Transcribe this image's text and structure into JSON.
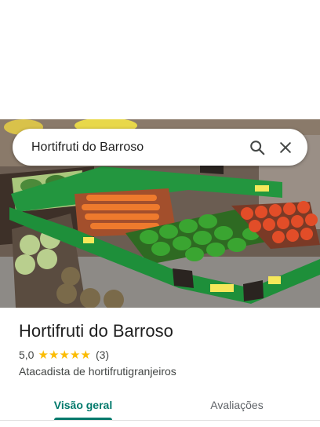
{
  "search": {
    "query": "Hortifruti do Barroso"
  },
  "icons": {
    "search": "search-icon",
    "close": "close-icon",
    "star": "star-icon"
  },
  "place": {
    "name": "Hortifruti do Barroso",
    "rating_value": "5,0",
    "rating_stars": 5,
    "review_count": "(3)",
    "category": "Atacadista de hortifrutigranjeiros"
  },
  "tabs": [
    {
      "label": "Visão geral",
      "active": true
    },
    {
      "label": "Avaliações",
      "active": false
    }
  ],
  "colors": {
    "accent": "#00796b",
    "star": "#fbbc04",
    "shelf_green": "#1e8f3a",
    "text_primary": "#1f1f1f",
    "text_secondary": "#444746"
  }
}
